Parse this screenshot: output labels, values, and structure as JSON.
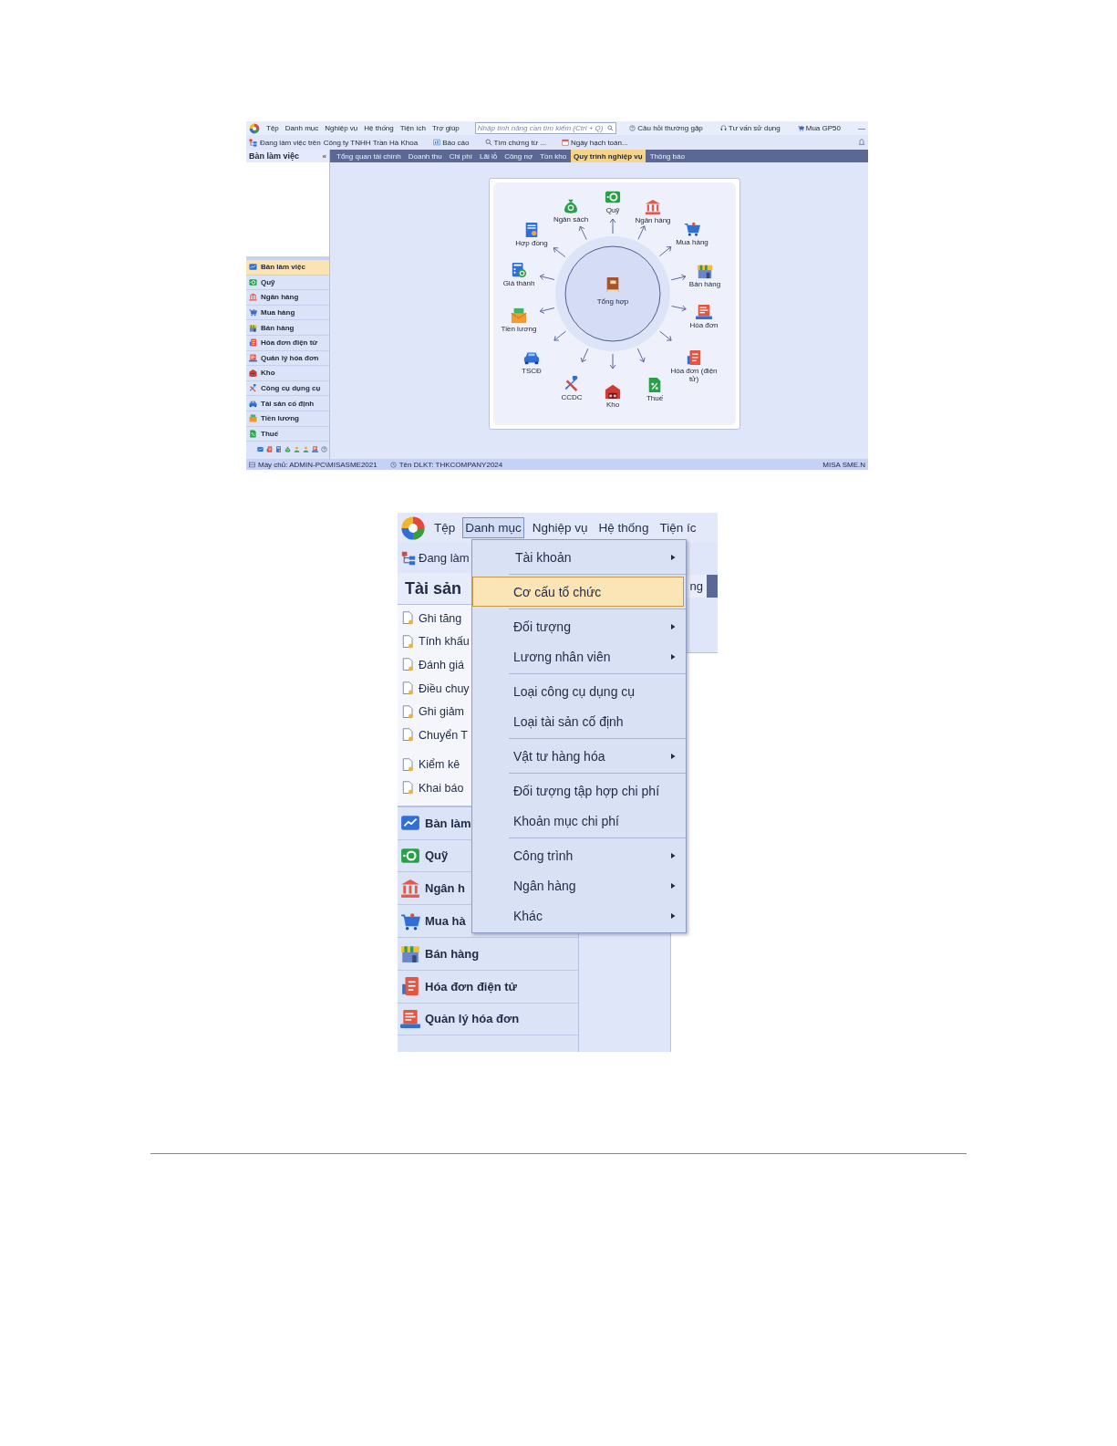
{
  "screenshot_1": {
    "menu_bar": {
      "menus": [
        "Tệp",
        "Danh mục",
        "Nghiệp vụ",
        "Hệ thống",
        "Tiện ích",
        "Trợ giúp"
      ],
      "search": {
        "placeholder": "Nhập tính năng cần tìm kiếm (Ctrl + Q)"
      },
      "links": [
        "Câu hỏi thường gặp",
        "Tư vấn sử dụng",
        "Mua GP50"
      ],
      "minimize": "—"
    },
    "toolbar": {
      "workspace_label": "Đang làm việc trên",
      "company": "Công ty TNHH Trần Hà Khoa",
      "buttons": [
        "Báo cáo",
        "Tìm chứng từ ...",
        "Ngày hạch toán..."
      ]
    },
    "sidebar": {
      "title": "Bàn làm việc",
      "collapse": "«",
      "items": [
        {
          "label": "Bàn làm việc",
          "selected": true
        },
        {
          "label": "Quỹ",
          "selected": false
        },
        {
          "label": "Ngân hàng",
          "selected": false
        },
        {
          "label": "Mua hàng",
          "selected": false
        },
        {
          "label": "Bán hàng",
          "selected": false
        },
        {
          "label": "Hóa đơn điện tử",
          "selected": false
        },
        {
          "label": "Quản lý hóa đơn",
          "selected": false
        },
        {
          "label": "Kho",
          "selected": false
        },
        {
          "label": "Công cụ dụng cụ",
          "selected": false
        },
        {
          "label": "Tài sản cố định",
          "selected": false
        },
        {
          "label": "Tiền lương",
          "selected": false
        },
        {
          "label": "Thuế",
          "selected": false
        }
      ]
    },
    "tabs": [
      {
        "label": "Tổng quan tài chính",
        "selected": false
      },
      {
        "label": "Doanh thu",
        "selected": false
      },
      {
        "label": "Chi phí",
        "selected": false
      },
      {
        "label": "Lãi lỗ",
        "selected": false
      },
      {
        "label": "Công nợ",
        "selected": false
      },
      {
        "label": "Tồn kho",
        "selected": false
      },
      {
        "label": "Quy trình nghiệp vụ",
        "selected": true
      },
      {
        "label": "Thông báo",
        "selected": false
      }
    ],
    "diagram": {
      "center": "Tổng hợp",
      "nodes": [
        "Ngân sách",
        "Quỹ",
        "Ngân hàng",
        "Hợp đồng",
        "Mua hàng",
        "Giá thành",
        "Bán hàng",
        "Tiền lương",
        "Hóa đơn",
        "TSCĐ",
        "Hóa đơn (điện tử)",
        "CCDC",
        "Kho",
        "Thuế"
      ]
    },
    "status_bar": {
      "server": "Máy chủ: ADMIN-PC\\MISASME2021",
      "database": "Tên DLKT: THKCOMPANY2024",
      "product": "MISA SME.N"
    }
  },
  "screenshot_2": {
    "menu_bar": {
      "items": [
        {
          "label": "Tệp",
          "selected": false
        },
        {
          "label": "Danh mục",
          "selected": true
        },
        {
          "label": "Nghiệp vụ",
          "selected": false
        },
        {
          "label": "Hệ thống",
          "selected": false
        },
        {
          "label": "Tiện íc",
          "selected": false
        }
      ]
    },
    "toolbar": {
      "workspace_label": "Đang làm"
    },
    "sidebar": {
      "title": "Tài sản",
      "document_groups": [
        [
          "Ghi tăng",
          "Tính khấu",
          "Đánh giá",
          "Điều chuy",
          "Ghi giảm",
          "Chuyển T"
        ],
        [
          "Kiểm kê",
          "Khai báo"
        ]
      ],
      "items": [
        "Bàn làm",
        "Quỹ",
        "Ngân h",
        "Mua hà",
        "Bán hàng",
        "Hóa đơn điện tử",
        "Quản lý hóa đơn"
      ]
    },
    "tab": "ng",
    "dropdown": {
      "groups": [
        [
          {
            "label": "Tài khoản",
            "submenu": true,
            "selected": false
          }
        ],
        [
          {
            "label": "Cơ cấu tổ chức",
            "submenu": false,
            "selected": true
          }
        ],
        [
          {
            "label": "Đối tượng",
            "submenu": true,
            "selected": false
          },
          {
            "label": "Lương nhân viên",
            "submenu": true,
            "selected": false
          }
        ],
        [
          {
            "label": "Loại công cụ dụng cụ",
            "submenu": false,
            "selected": false
          },
          {
            "label": "Loại tài sản cố định",
            "submenu": false,
            "selected": false
          }
        ],
        [
          {
            "label": "Vật tư hàng hóa",
            "submenu": true,
            "selected": false
          }
        ],
        [
          {
            "label": "Đối tượng tập hợp chi phí",
            "submenu": false,
            "selected": false
          },
          {
            "label": "Khoản mục chi phí",
            "submenu": false,
            "selected": false
          }
        ],
        [
          {
            "label": "Công trình",
            "submenu": true,
            "selected": false
          },
          {
            "label": "Ngân hàng",
            "submenu": true,
            "selected": false
          },
          {
            "label": "Khác",
            "submenu": true,
            "selected": false
          }
        ]
      ]
    }
  }
}
